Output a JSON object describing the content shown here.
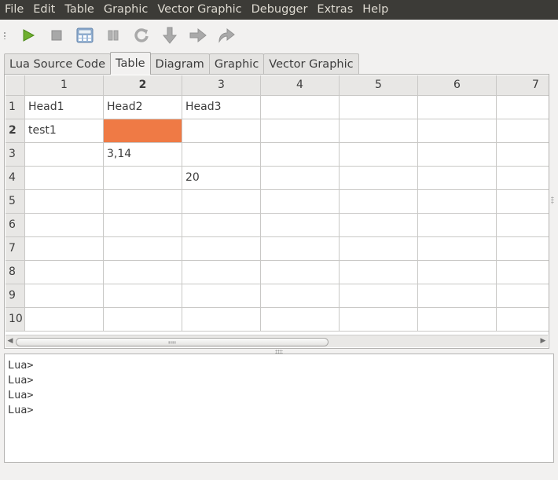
{
  "menubar": {
    "items": [
      "File",
      "Edit",
      "Table",
      "Graphic",
      "Vector Graphic",
      "Debugger",
      "Extras",
      "Help"
    ]
  },
  "toolbar": {
    "buttons": [
      {
        "icon": "play-icon",
        "enabled": true
      },
      {
        "icon": "stop-icon",
        "enabled": false
      },
      {
        "icon": "calculator-icon",
        "enabled": true
      },
      {
        "icon": "pause-icon",
        "enabled": false
      },
      {
        "icon": "restart-icon",
        "enabled": false
      },
      {
        "icon": "step-into-icon",
        "enabled": false
      },
      {
        "icon": "step-over-icon",
        "enabled": false
      },
      {
        "icon": "step-out-icon",
        "enabled": false
      }
    ]
  },
  "tabs": [
    {
      "label": "Lua Source Code",
      "active": false
    },
    {
      "label": "Table",
      "active": true
    },
    {
      "label": "Diagram",
      "active": false
    },
    {
      "label": "Graphic",
      "active": false
    },
    {
      "label": "Vector Graphic",
      "active": false
    }
  ],
  "table": {
    "columns": [
      "1",
      "2",
      "3",
      "4",
      "5",
      "6",
      "7"
    ],
    "selected_column": "2",
    "selected_row": "2",
    "selected_color": "#ef7a45",
    "rows": [
      {
        "label": "1",
        "cells": [
          "Head1",
          "Head2",
          "Head3",
          "",
          "",
          "",
          ""
        ]
      },
      {
        "label": "2",
        "cells": [
          "test1",
          "",
          "",
          "",
          "",
          "",
          ""
        ]
      },
      {
        "label": "3",
        "cells": [
          "",
          "3,14",
          "",
          "",
          "",
          "",
          ""
        ]
      },
      {
        "label": "4",
        "cells": [
          "",
          "",
          "20",
          "",
          "",
          "",
          ""
        ]
      },
      {
        "label": "5",
        "cells": [
          "",
          "",
          "",
          "",
          "",
          "",
          ""
        ]
      },
      {
        "label": "6",
        "cells": [
          "",
          "",
          "",
          "",
          "",
          "",
          ""
        ]
      },
      {
        "label": "7",
        "cells": [
          "",
          "",
          "",
          "",
          "",
          "",
          ""
        ]
      },
      {
        "label": "8",
        "cells": [
          "",
          "",
          "",
          "",
          "",
          "",
          ""
        ]
      },
      {
        "label": "9",
        "cells": [
          "",
          "",
          "",
          "",
          "",
          "",
          ""
        ]
      },
      {
        "label": "10",
        "cells": [
          "",
          "",
          "",
          "",
          "",
          "",
          ""
        ]
      }
    ]
  },
  "console": {
    "lines": [
      "Lua>",
      "Lua>",
      "Lua>",
      "Lua>"
    ]
  }
}
